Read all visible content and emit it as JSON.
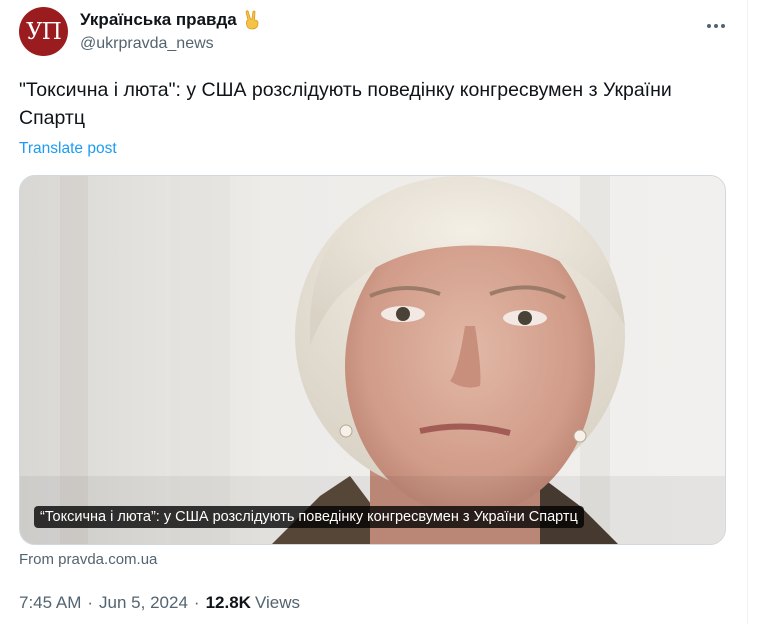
{
  "author": {
    "avatar_text": "УП",
    "display_name": "Українська правда",
    "handle": "@ukrpravda_news"
  },
  "post": {
    "text": "\"Токсична і люта\": у США розслідують поведінку конгресвумен з України Спартц",
    "translate_label": "Translate post"
  },
  "card": {
    "caption": "“Токсична і люта”: у США розслідують поведінку конгресвумен з України Спартц",
    "source": "From pravda.com.ua"
  },
  "meta": {
    "time": "7:45 AM",
    "date": "Jun 5, 2024",
    "views_count": "12.8K",
    "views_label": "Views"
  },
  "icons": {
    "verified_badge": "victory-hand-icon",
    "more": "more-options-icon"
  },
  "colors": {
    "link": "#1d9bf0",
    "secondary_text": "#536471",
    "avatar_bg": "#9b1c1f"
  }
}
